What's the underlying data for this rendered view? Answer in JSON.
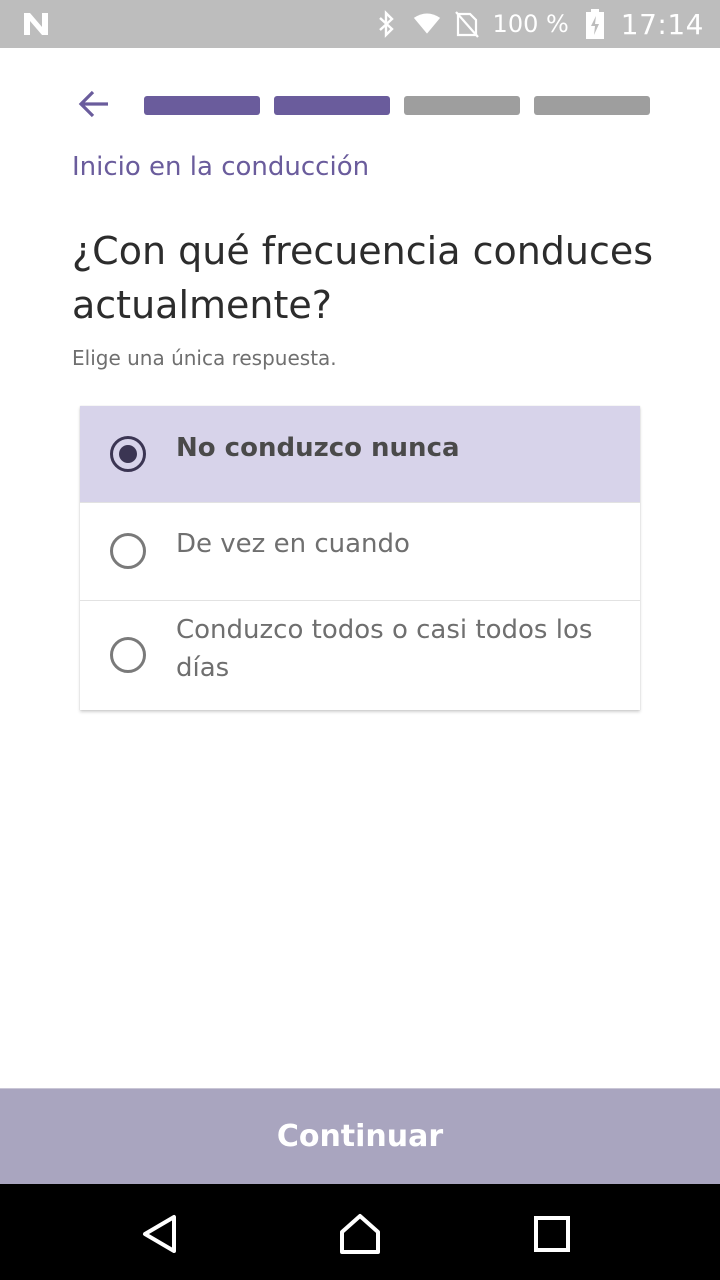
{
  "status_bar": {
    "battery": "100 %",
    "time": "17:14",
    "icons": [
      "n-logo-icon",
      "bluetooth-icon",
      "wifi-icon",
      "no-sim-icon",
      "battery-charging-icon"
    ]
  },
  "header": {
    "back_icon": "arrow-left-icon",
    "progress": {
      "total_steps": 4,
      "completed_steps": 2
    }
  },
  "section_title": "Inicio en la conducción",
  "question": "¿Con qué frecuencia conduces actualmente?",
  "hint": "Elige una única respuesta.",
  "options": [
    {
      "label": "No conduzco nunca",
      "selected": true
    },
    {
      "label": "De vez en cuando",
      "selected": false
    },
    {
      "label": "Conduzco todos o casi todos los días",
      "selected": false
    }
  ],
  "continue_label": "Continuar",
  "colors": {
    "accent": "#6a5c9c",
    "selected_option_bg": "#d7d3ea",
    "continue_bg": "#a9a5bf"
  },
  "nav": {
    "icons": [
      "back-triangle-icon",
      "home-icon",
      "recents-icon"
    ]
  }
}
